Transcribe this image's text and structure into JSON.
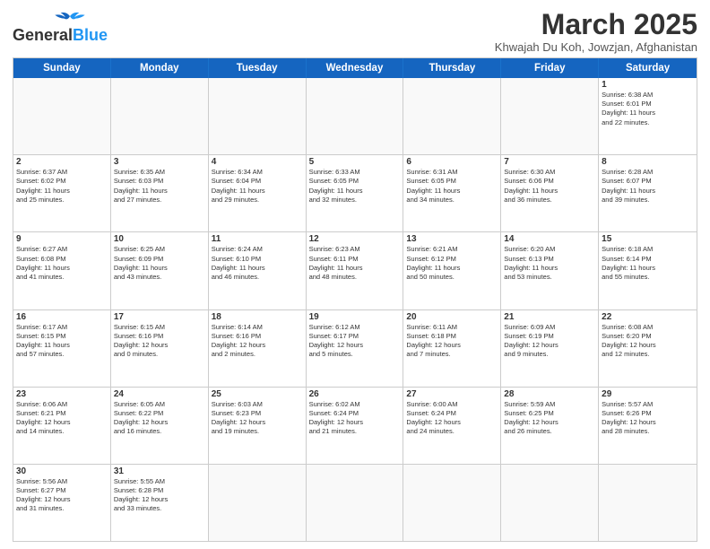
{
  "header": {
    "logo_general": "General",
    "logo_blue": "Blue",
    "month_title": "March 2025",
    "location": "Khwajah Du Koh, Jowzjan, Afghanistan"
  },
  "days_of_week": [
    "Sunday",
    "Monday",
    "Tuesday",
    "Wednesday",
    "Thursday",
    "Friday",
    "Saturday"
  ],
  "weeks": [
    [
      {
        "day": "",
        "info": ""
      },
      {
        "day": "",
        "info": ""
      },
      {
        "day": "",
        "info": ""
      },
      {
        "day": "",
        "info": ""
      },
      {
        "day": "",
        "info": ""
      },
      {
        "day": "",
        "info": ""
      },
      {
        "day": "1",
        "info": "Sunrise: 6:38 AM\nSunset: 6:01 PM\nDaylight: 11 hours\nand 22 minutes."
      }
    ],
    [
      {
        "day": "2",
        "info": "Sunrise: 6:37 AM\nSunset: 6:02 PM\nDaylight: 11 hours\nand 25 minutes."
      },
      {
        "day": "3",
        "info": "Sunrise: 6:35 AM\nSunset: 6:03 PM\nDaylight: 11 hours\nand 27 minutes."
      },
      {
        "day": "4",
        "info": "Sunrise: 6:34 AM\nSunset: 6:04 PM\nDaylight: 11 hours\nand 29 minutes."
      },
      {
        "day": "5",
        "info": "Sunrise: 6:33 AM\nSunset: 6:05 PM\nDaylight: 11 hours\nand 32 minutes."
      },
      {
        "day": "6",
        "info": "Sunrise: 6:31 AM\nSunset: 6:05 PM\nDaylight: 11 hours\nand 34 minutes."
      },
      {
        "day": "7",
        "info": "Sunrise: 6:30 AM\nSunset: 6:06 PM\nDaylight: 11 hours\nand 36 minutes."
      },
      {
        "day": "8",
        "info": "Sunrise: 6:28 AM\nSunset: 6:07 PM\nDaylight: 11 hours\nand 39 minutes."
      }
    ],
    [
      {
        "day": "9",
        "info": "Sunrise: 6:27 AM\nSunset: 6:08 PM\nDaylight: 11 hours\nand 41 minutes."
      },
      {
        "day": "10",
        "info": "Sunrise: 6:25 AM\nSunset: 6:09 PM\nDaylight: 11 hours\nand 43 minutes."
      },
      {
        "day": "11",
        "info": "Sunrise: 6:24 AM\nSunset: 6:10 PM\nDaylight: 11 hours\nand 46 minutes."
      },
      {
        "day": "12",
        "info": "Sunrise: 6:23 AM\nSunset: 6:11 PM\nDaylight: 11 hours\nand 48 minutes."
      },
      {
        "day": "13",
        "info": "Sunrise: 6:21 AM\nSunset: 6:12 PM\nDaylight: 11 hours\nand 50 minutes."
      },
      {
        "day": "14",
        "info": "Sunrise: 6:20 AM\nSunset: 6:13 PM\nDaylight: 11 hours\nand 53 minutes."
      },
      {
        "day": "15",
        "info": "Sunrise: 6:18 AM\nSunset: 6:14 PM\nDaylight: 11 hours\nand 55 minutes."
      }
    ],
    [
      {
        "day": "16",
        "info": "Sunrise: 6:17 AM\nSunset: 6:15 PM\nDaylight: 11 hours\nand 57 minutes."
      },
      {
        "day": "17",
        "info": "Sunrise: 6:15 AM\nSunset: 6:16 PM\nDaylight: 12 hours\nand 0 minutes."
      },
      {
        "day": "18",
        "info": "Sunrise: 6:14 AM\nSunset: 6:16 PM\nDaylight: 12 hours\nand 2 minutes."
      },
      {
        "day": "19",
        "info": "Sunrise: 6:12 AM\nSunset: 6:17 PM\nDaylight: 12 hours\nand 5 minutes."
      },
      {
        "day": "20",
        "info": "Sunrise: 6:11 AM\nSunset: 6:18 PM\nDaylight: 12 hours\nand 7 minutes."
      },
      {
        "day": "21",
        "info": "Sunrise: 6:09 AM\nSunset: 6:19 PM\nDaylight: 12 hours\nand 9 minutes."
      },
      {
        "day": "22",
        "info": "Sunrise: 6:08 AM\nSunset: 6:20 PM\nDaylight: 12 hours\nand 12 minutes."
      }
    ],
    [
      {
        "day": "23",
        "info": "Sunrise: 6:06 AM\nSunset: 6:21 PM\nDaylight: 12 hours\nand 14 minutes."
      },
      {
        "day": "24",
        "info": "Sunrise: 6:05 AM\nSunset: 6:22 PM\nDaylight: 12 hours\nand 16 minutes."
      },
      {
        "day": "25",
        "info": "Sunrise: 6:03 AM\nSunset: 6:23 PM\nDaylight: 12 hours\nand 19 minutes."
      },
      {
        "day": "26",
        "info": "Sunrise: 6:02 AM\nSunset: 6:24 PM\nDaylight: 12 hours\nand 21 minutes."
      },
      {
        "day": "27",
        "info": "Sunrise: 6:00 AM\nSunset: 6:24 PM\nDaylight: 12 hours\nand 24 minutes."
      },
      {
        "day": "28",
        "info": "Sunrise: 5:59 AM\nSunset: 6:25 PM\nDaylight: 12 hours\nand 26 minutes."
      },
      {
        "day": "29",
        "info": "Sunrise: 5:57 AM\nSunset: 6:26 PM\nDaylight: 12 hours\nand 28 minutes."
      }
    ],
    [
      {
        "day": "30",
        "info": "Sunrise: 5:56 AM\nSunset: 6:27 PM\nDaylight: 12 hours\nand 31 minutes."
      },
      {
        "day": "31",
        "info": "Sunrise: 5:55 AM\nSunset: 6:28 PM\nDaylight: 12 hours\nand 33 minutes."
      },
      {
        "day": "",
        "info": ""
      },
      {
        "day": "",
        "info": ""
      },
      {
        "day": "",
        "info": ""
      },
      {
        "day": "",
        "info": ""
      },
      {
        "day": "",
        "info": ""
      }
    ]
  ]
}
